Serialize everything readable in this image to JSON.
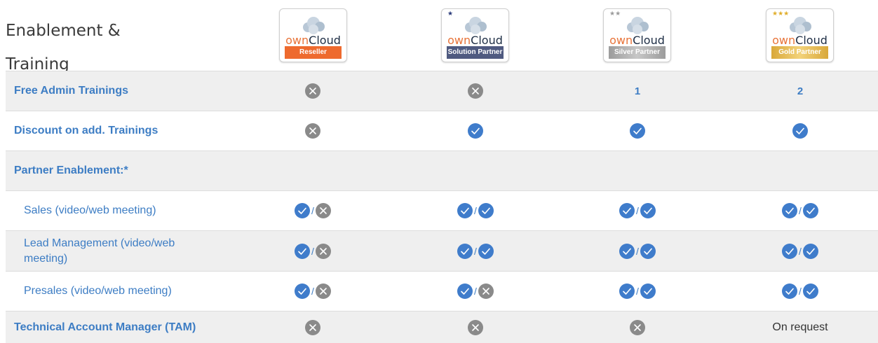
{
  "title": "Enablement & Training",
  "badges": [
    {
      "brand_own": "own",
      "brand_cloud": "Cloud",
      "stars": "",
      "ribbon": "Reseller",
      "ribbon_color": "#ee6a2e",
      "star_color": ""
    },
    {
      "brand_own": "own",
      "brand_cloud": "Cloud",
      "stars": "★",
      "ribbon": "Solution Partner",
      "ribbon_color": "#4f5a80",
      "star_color": "#2a3a7a"
    },
    {
      "brand_own": "own",
      "brand_cloud": "Cloud",
      "stars": "★★",
      "ribbon": "Silver Partner",
      "ribbon_color": "#a9a9a9",
      "star_color": "#9a9a9a"
    },
    {
      "brand_own": "own",
      "brand_cloud": "Cloud",
      "stars": "★★★",
      "ribbon": "Gold Partner",
      "ribbon_color": "#e3b84a",
      "star_color": "#e0ad2a"
    }
  ],
  "colors": {
    "accent": "#3d7dc4",
    "check": "#3f7ccb",
    "cross": "#8a8a8a"
  },
  "rows": [
    {
      "label": "Free Admin Trainings",
      "cells": [
        "cross",
        "cross",
        "1",
        "2"
      ]
    },
    {
      "label": "Discount on add. Trainings",
      "cells": [
        "check",
        "check",
        "check",
        "check"
      ]
    },
    {
      "label": "Partner Enablement:*",
      "cells": []
    },
    {
      "label": "Sales (video/web meeting)",
      "cells": [
        "check/cross",
        "check/check",
        "check/check",
        "check/check"
      ]
    },
    {
      "label": "Lead Management (video/web meeting)",
      "cells": [
        "check/cross",
        "check/check",
        "check/check",
        "check/check"
      ]
    },
    {
      "label": "Presales (video/web meeting)",
      "cells": [
        "check/cross",
        "check/cross",
        "check/check",
        "check/check"
      ]
    },
    {
      "label": "Technical Account Manager (TAM)",
      "cells": [
        "cross",
        "cross",
        "cross",
        "On request"
      ]
    }
  ],
  "row_values": {
    "free_admin_silver": "1",
    "free_admin_gold": "2",
    "tam_gold": "On request",
    "slash": "/"
  }
}
